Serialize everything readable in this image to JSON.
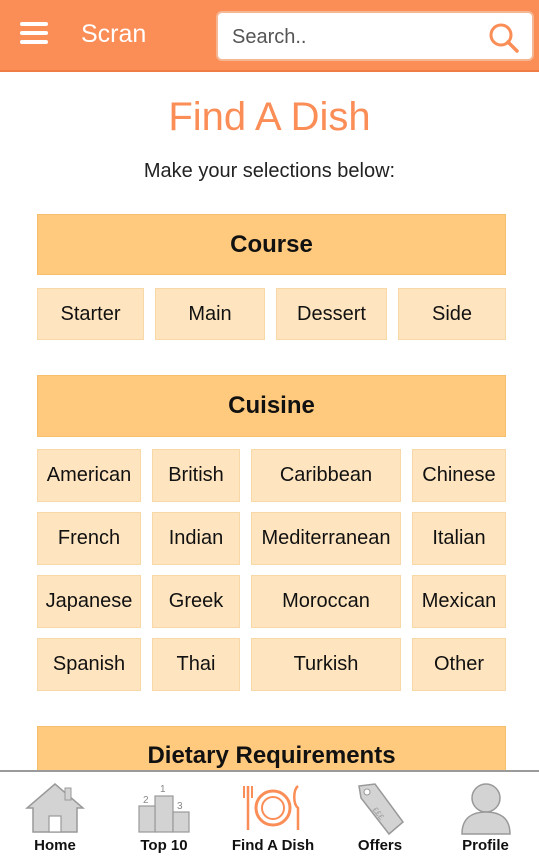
{
  "header": {
    "brand": "Scran",
    "search_placeholder": "Search.."
  },
  "page": {
    "title": "Find A Dish",
    "subtitle": "Make your selections below:"
  },
  "course": {
    "title": "Course",
    "options": [
      "Starter",
      "Main",
      "Dessert",
      "Side"
    ]
  },
  "cuisine": {
    "title": "Cuisine",
    "options": [
      "American",
      "British",
      "Caribbean",
      "Chinese",
      "French",
      "Indian",
      "Mediterranean",
      "Italian",
      "Japanese",
      "Greek",
      "Moroccan",
      "Mexican",
      "Spanish",
      "Thai",
      "Turkish",
      "Other"
    ]
  },
  "dietary": {
    "title": "Dietary Requirements"
  },
  "nav": {
    "items": [
      "Home",
      "Top 10",
      "Find A Dish",
      "Offers",
      "Profile"
    ],
    "active": "Find A Dish",
    "icons": [
      "home-icon",
      "podium-icon",
      "plate-cutlery-icon",
      "tag-icon",
      "profile-icon"
    ]
  },
  "colors": {
    "accent": "#fb8d57",
    "header_fill": "#ffca7e",
    "option_fill": "#ffe5bf"
  }
}
